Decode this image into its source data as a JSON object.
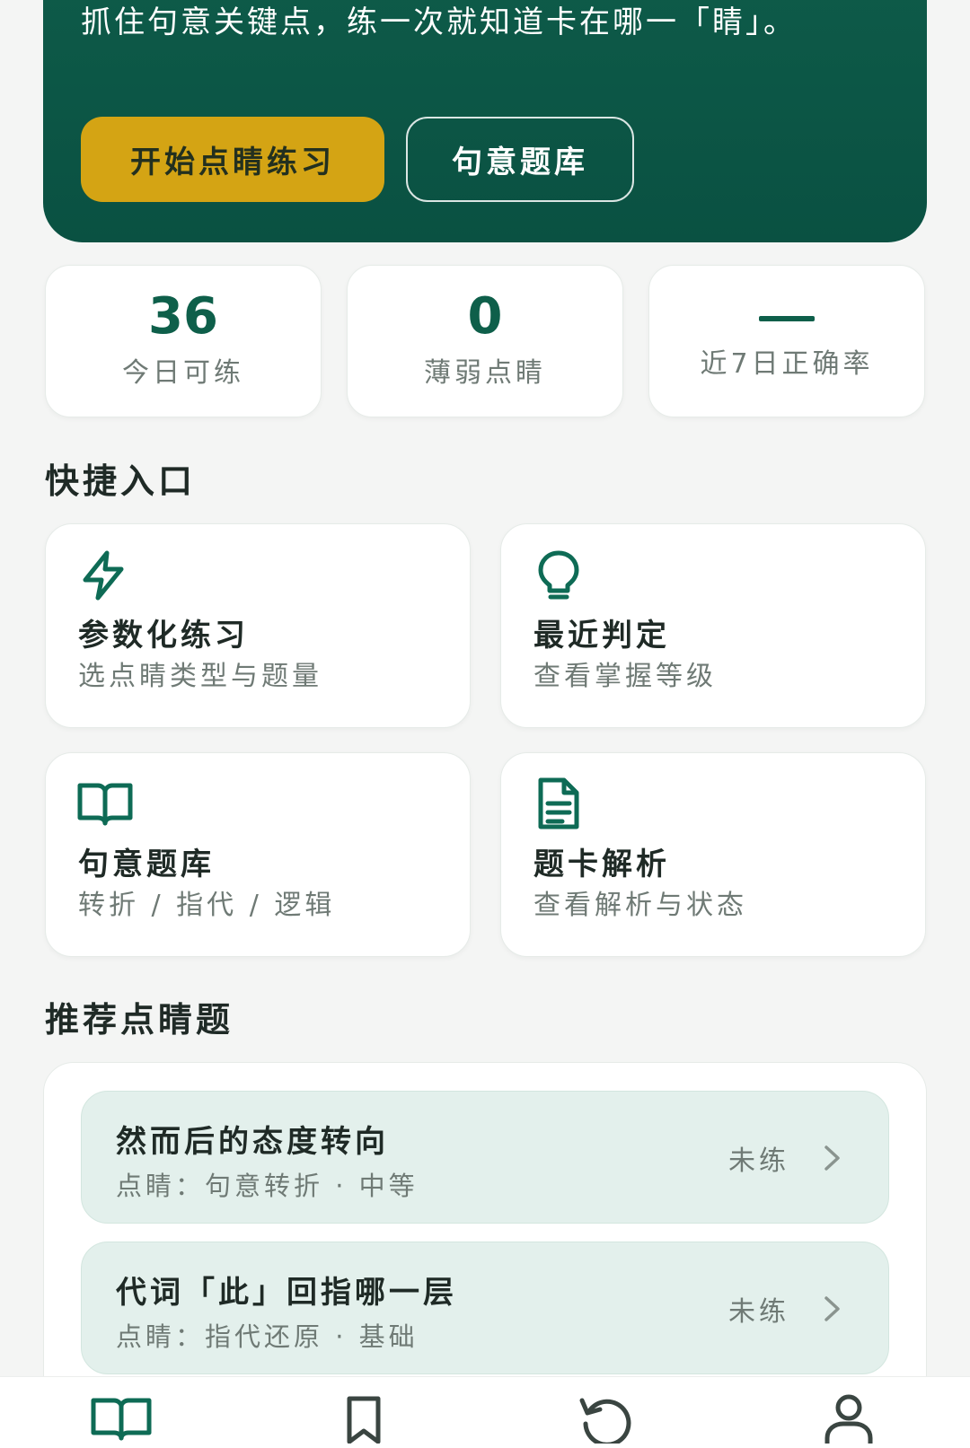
{
  "hero": {
    "text": "抓住句意关键点，练一次就知道卡在哪一「睛」。",
    "primary_button": "开始点睛练习",
    "secondary_button": "句意题库"
  },
  "stats": [
    {
      "value": "36",
      "label": "今日可练"
    },
    {
      "value": "0",
      "label": "薄弱点睛"
    },
    {
      "value": "—",
      "label": "近7日正确率"
    }
  ],
  "quick": {
    "title": "快捷入口",
    "items": [
      {
        "icon": "lightning-icon",
        "title": "参数化练习",
        "subtitle": "选点睛类型与题量"
      },
      {
        "icon": "lightbulb-icon",
        "title": "最近判定",
        "subtitle": "查看掌握等级"
      },
      {
        "icon": "book-icon",
        "title": "句意题库",
        "subtitle": "转折 / 指代 / 逻辑"
      },
      {
        "icon": "document-icon",
        "title": "题卡解析",
        "subtitle": "查看解析与状态"
      }
    ]
  },
  "recommend": {
    "title": "推荐点睛题",
    "items": [
      {
        "title": "然而后的态度转向",
        "meta": "点睛：句意转折 · 中等",
        "status": "未练"
      },
      {
        "title": "代词「此」回指哪一层",
        "meta": "点睛：指代还原 · 基础",
        "status": "未练"
      }
    ]
  },
  "bottom_nav": [
    {
      "icon": "book-icon",
      "active": true
    },
    {
      "icon": "bookmark-icon",
      "active": false
    },
    {
      "icon": "history-icon",
      "active": false
    },
    {
      "icon": "user-icon",
      "active": false
    }
  ],
  "colors": {
    "brand_green": "#0e5b49",
    "accent_gold": "#d4a414",
    "card_tint": "#e3f0ec",
    "muted_text": "#6f7a75"
  }
}
